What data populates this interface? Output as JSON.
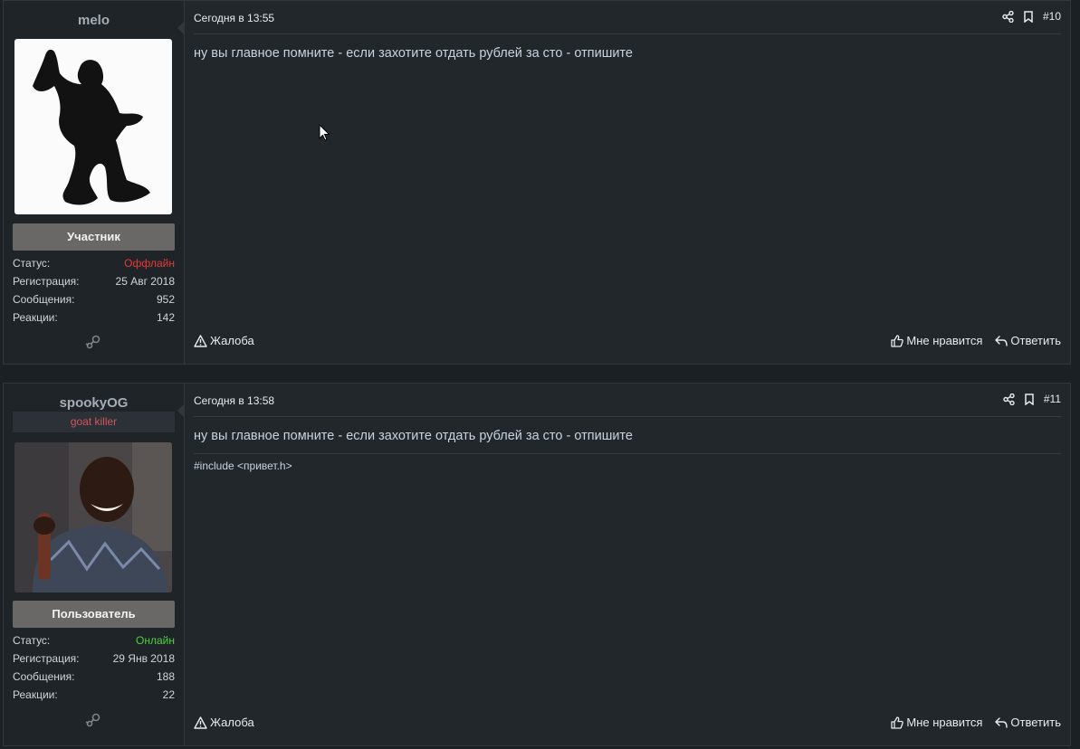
{
  "posts": [
    {
      "username": "melo",
      "user_title": "",
      "role": "Участник",
      "stats": [
        {
          "label": "Статус:",
          "value": "Оффлайн",
          "status": "offline"
        },
        {
          "label": "Регистрация:",
          "value": "25 Авг 2018"
        },
        {
          "label": "Сообщения:",
          "value": "952"
        },
        {
          "label": "Реакции:",
          "value": "142"
        }
      ],
      "date": "Сегодня в 13:55",
      "number": "#10",
      "message": "ну вы главное помните - если захотите отдать рублей за сто - отпишите",
      "signature": "",
      "report_label": "Жалоба",
      "like_label": "Мне нравится",
      "reply_label": "Ответить"
    },
    {
      "username": "spookyOG",
      "user_title": "goat killer",
      "role": "Пользователь",
      "stats": [
        {
          "label": "Статус:",
          "value": "Онлайн",
          "status": "online"
        },
        {
          "label": "Регистрация:",
          "value": "29 Янв 2018"
        },
        {
          "label": "Сообщения:",
          "value": "188"
        },
        {
          "label": "Реакции:",
          "value": "22"
        }
      ],
      "date": "Сегодня в 13:58",
      "number": "#11",
      "message": "ну вы главное помните - если захотите отдать рублей за сто - отпишите",
      "signature": "#include <привет.h>",
      "report_label": "Жалоба",
      "like_label": "Мне нравится",
      "reply_label": "Ответить"
    }
  ],
  "icons": {
    "share": "share-icon",
    "bookmark": "bookmark-icon",
    "report": "warning-icon",
    "like": "thumbs-up-icon",
    "reply": "reply-icon",
    "steam": "steam-icon"
  },
  "colors": {
    "offline": "#e53935",
    "online": "#4cd23c",
    "user_title": "#d0565b"
  }
}
